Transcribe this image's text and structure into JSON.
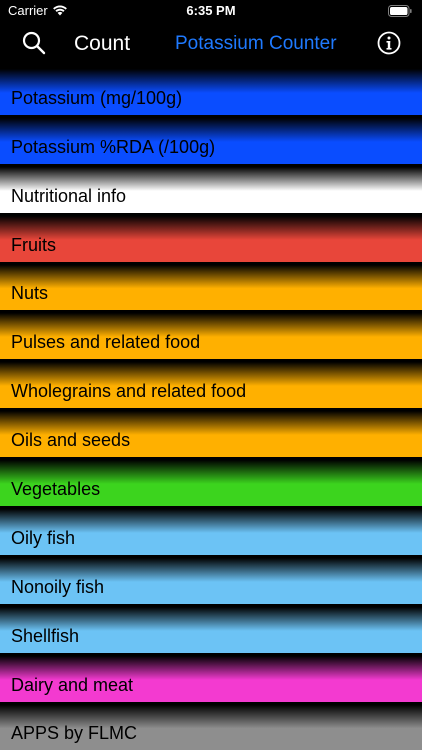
{
  "status": {
    "carrier": "Carrier",
    "time": "6:35 PM"
  },
  "nav": {
    "count_label": "Count",
    "title": "Potassium Counter",
    "search_icon": "search-icon",
    "info_icon": "info-icon"
  },
  "colors": {
    "accent": "#1f7aff",
    "blue": "#0a4dff",
    "white": "#ffffff",
    "red": "#e8463a",
    "orange": "#ffb000",
    "green": "#3cd41e",
    "lightblue": "#6cc3f5",
    "magenta": "#f33ad0",
    "gray": "#8e8e8e"
  },
  "rows": [
    {
      "label": "Potassium (mg/100g)",
      "color": "#0a4dff"
    },
    {
      "label": "Potassium %RDA (/100g)",
      "color": "#0a4dff"
    },
    {
      "label": "Nutritional info",
      "color": "#ffffff"
    },
    {
      "label": "Fruits",
      "color": "#e8463a"
    },
    {
      "label": "Nuts",
      "color": "#ffb000"
    },
    {
      "label": "Pulses and related food",
      "color": "#ffb000"
    },
    {
      "label": "Wholegrains and related food",
      "color": "#ffb000"
    },
    {
      "label": "Oils and seeds",
      "color": "#ffb000"
    },
    {
      "label": "Vegetables",
      "color": "#3cd41e"
    },
    {
      "label": "Oily fish",
      "color": "#6cc3f5"
    },
    {
      "label": "Nonoily fish",
      "color": "#6cc3f5"
    },
    {
      "label": "Shellfish",
      "color": "#6cc3f5"
    },
    {
      "label": "Dairy and meat",
      "color": "#f33ad0"
    },
    {
      "label": "APPS by FLMC",
      "color": "#8e8e8e"
    }
  ]
}
